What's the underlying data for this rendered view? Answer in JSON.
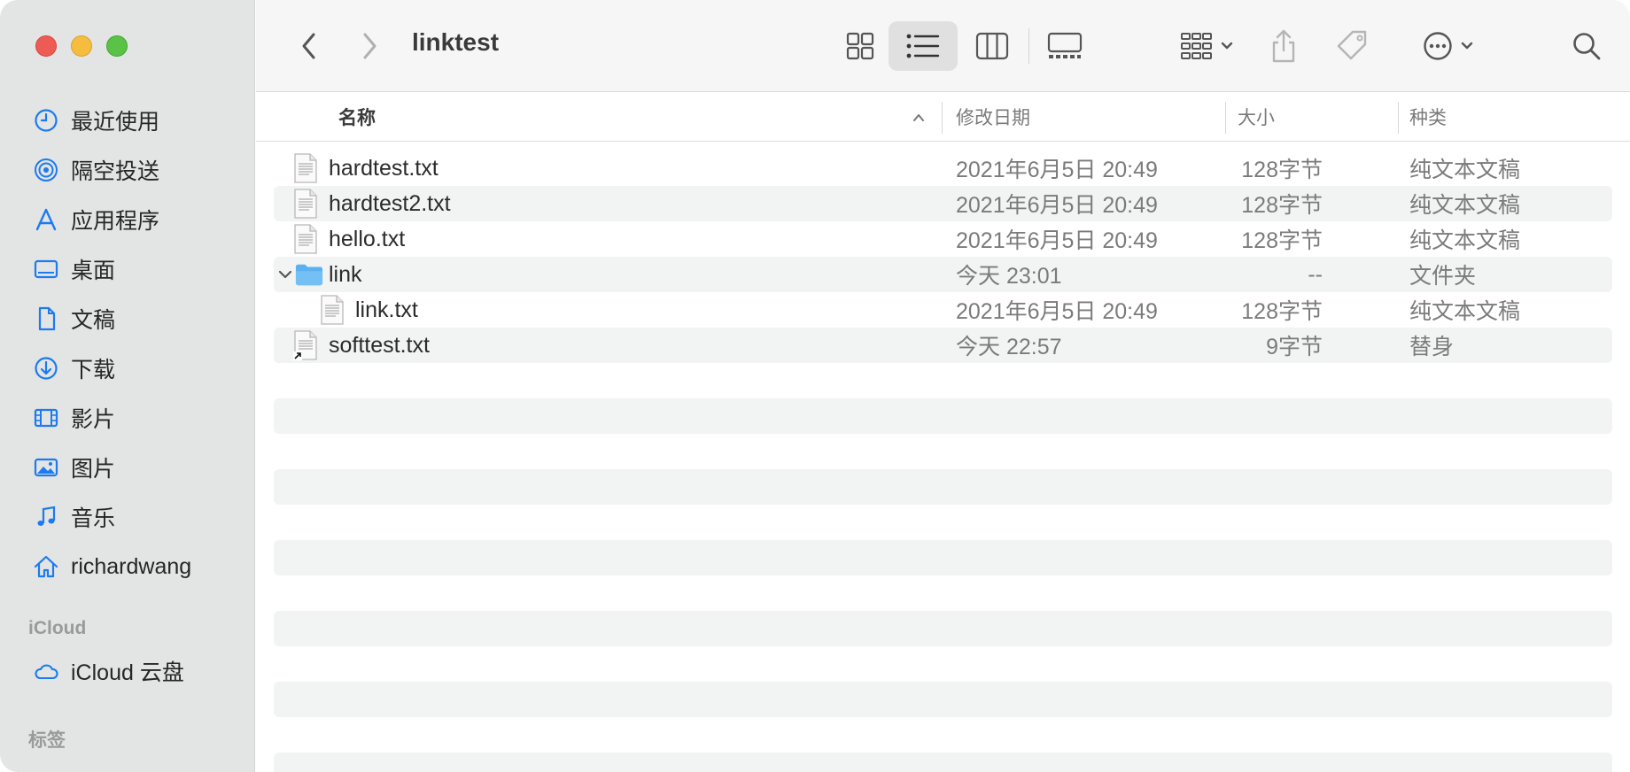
{
  "window": {
    "title": "linktest"
  },
  "sidebar": {
    "favorites": [
      {
        "label": "最近使用",
        "icon": "clock-icon"
      },
      {
        "label": "隔空投送",
        "icon": "airdrop-icon"
      },
      {
        "label": "应用程序",
        "icon": "applications-icon"
      },
      {
        "label": "桌面",
        "icon": "desktop-icon"
      },
      {
        "label": "文稿",
        "icon": "document-icon"
      },
      {
        "label": "下载",
        "icon": "download-icon"
      },
      {
        "label": "影片",
        "icon": "film-icon"
      },
      {
        "label": "图片",
        "icon": "photo-icon"
      },
      {
        "label": "音乐",
        "icon": "music-icon"
      },
      {
        "label": "richardwang",
        "icon": "home-icon"
      }
    ],
    "icloud_section": "iCloud",
    "icloud_items": [
      {
        "label": "iCloud 云盘",
        "icon": "cloud-icon"
      }
    ],
    "tags_section": "标签"
  },
  "columns": {
    "name": "名称",
    "date": "修改日期",
    "size": "大小",
    "kind": "种类"
  },
  "files": [
    {
      "name": "hardtest.txt",
      "date": "2021年6月5日 20:49",
      "size": "128字节",
      "kind": "纯文本文稿",
      "type": "text"
    },
    {
      "name": "hardtest2.txt",
      "date": "2021年6月5日 20:49",
      "size": "128字节",
      "kind": "纯文本文稿",
      "type": "text"
    },
    {
      "name": "hello.txt",
      "date": "2021年6月5日 20:49",
      "size": "128字节",
      "kind": "纯文本文稿",
      "type": "text"
    },
    {
      "name": "link",
      "date": "今天 23:01",
      "size": "--",
      "kind": "文件夹",
      "type": "folder"
    },
    {
      "name": "link.txt",
      "date": "2021年6月5日 20:49",
      "size": "128字节",
      "kind": "纯文本文稿",
      "type": "text"
    },
    {
      "name": "softtest.txt",
      "date": "今天 22:57",
      "size": "9字节",
      "kind": "替身",
      "type": "alias"
    }
  ],
  "colors": {
    "accent": "#1b7bf0",
    "folder": "#5ab0f0"
  }
}
